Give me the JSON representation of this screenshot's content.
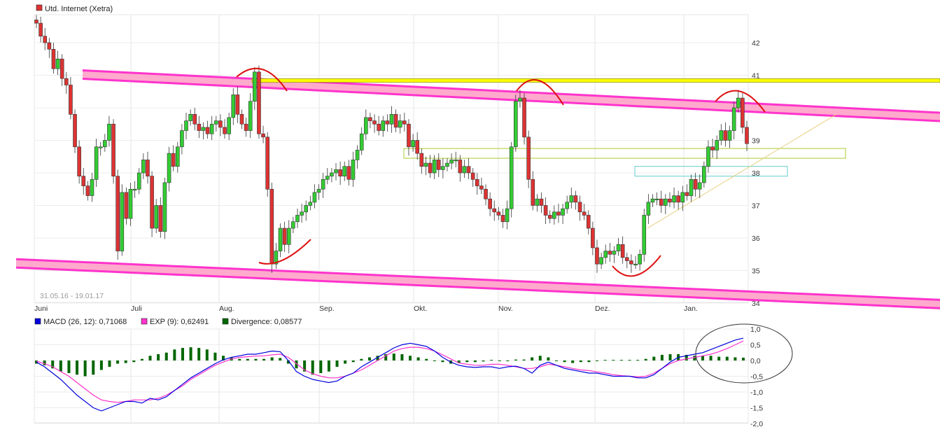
{
  "chart_data": [
    {
      "type": "candlestick",
      "title": "Utd. Internet (Xetra)",
      "date_range_label": "31.05.16 - 19.01.17",
      "x_ticks": [
        "Juni",
        "Juli",
        "Aug.",
        "Sep.",
        "Okt.",
        "Nov.",
        "Dez.",
        "Jan."
      ],
      "y_ticks": [
        "42",
        "41",
        "40",
        "39",
        "38",
        "37",
        "36",
        "35",
        "34"
      ],
      "ylim": [
        33.8,
        42.8
      ],
      "colors": {
        "up": "#33cc33",
        "down": "#dd3333",
        "channel": "#ff33cc",
        "channel_fill": "#ffaacc",
        "resistance": "#ffff00",
        "annotation": "#dd1111"
      },
      "closes": [
        42.6,
        42.2,
        42.0,
        41.8,
        41.2,
        41.5,
        40.9,
        40.7,
        39.8,
        38.8,
        37.9,
        37.6,
        37.3,
        37.8,
        38.8,
        38.8,
        39.0,
        39.5,
        37.9,
        35.6,
        37.4,
        36.6,
        37.5,
        37.5,
        38.0,
        38.4,
        37.9,
        36.3,
        37.0,
        36.2,
        37.7,
        38.6,
        38.2,
        38.8,
        39.3,
        39.6,
        39.8,
        39.5,
        39.3,
        39.4,
        39.2,
        39.5,
        39.6,
        39.4,
        39.2,
        39.7,
        40.4,
        39.8,
        39.5,
        39.3,
        40.2,
        41.1,
        39.2,
        39.1,
        37.5,
        35.2,
        35.6,
        36.3,
        35.8,
        36.3,
        36.5,
        36.7,
        36.8,
        37.0,
        37.1,
        37.4,
        37.5,
        37.8,
        37.9,
        38.0,
        38.1,
        37.9,
        38.2,
        37.8,
        38.4,
        38.7,
        39.2,
        39.7,
        39.6,
        39.5,
        39.3,
        39.6,
        39.5,
        39.8,
        39.4,
        39.6,
        39.5,
        38.8,
        39.0,
        38.6,
        38.2,
        38.3,
        38.0,
        38.4,
        38.1,
        38.2,
        38.3,
        38.4,
        38.4,
        38.0,
        38.2,
        38.0,
        37.8,
        37.6,
        37.5,
        37.2,
        36.9,
        36.8,
        36.7,
        36.5,
        36.9,
        38.8,
        40.2,
        40.3,
        39.1,
        37.8,
        37.0,
        37.2,
        37.0,
        36.7,
        36.6,
        36.8,
        36.7,
        36.9,
        37.1,
        37.3,
        37.1,
        36.8,
        36.7,
        36.3,
        35.7,
        35.2,
        35.4,
        35.6,
        35.5,
        35.6,
        35.8,
        35.4,
        35.3,
        35.2,
        35.2,
        35.5,
        36.7,
        37.1,
        37.2,
        37.2,
        37.0,
        37.2,
        37.1,
        37.3,
        37.1,
        37.4,
        37.3,
        37.8,
        37.5,
        37.7,
        38.2,
        38.8,
        38.7,
        39.0,
        39.3,
        39.0,
        39.3,
        40.0,
        40.3,
        39.4,
        38.9
      ],
      "overlays": {
        "channel_upper": [
          [
            2016.41,
            41.15
          ],
          [
            2017.13,
            39.85
          ]
        ],
        "channel_lower": [
          [
            2016.4,
            35.35
          ],
          [
            2017.13,
            34.1
          ]
        ],
        "resistance_level": 40.85,
        "box_yellow_green": [
          38.45,
          38.75
        ],
        "box_cyan": [
          37.9,
          38.2
        ]
      }
    },
    {
      "type": "line",
      "series": [
        {
          "name": "MACD (26, 12): 0,71068",
          "color": "#0000dd",
          "values": [
            -0.05,
            -0.2,
            -0.4,
            -0.6,
            -0.85,
            -1.1,
            -1.3,
            -1.5,
            -1.6,
            -1.5,
            -1.4,
            -1.3,
            -1.3,
            -1.35,
            -1.2,
            -1.25,
            -1.15,
            -0.95,
            -0.75,
            -0.55,
            -0.4,
            -0.25,
            -0.1,
            0.02,
            0.1,
            0.15,
            0.2,
            0.2,
            0.25,
            0.3,
            0.28,
            0.0,
            -0.35,
            -0.5,
            -0.6,
            -0.65,
            -0.7,
            -0.65,
            -0.5,
            -0.4,
            -0.2,
            -0.05,
            0.1,
            0.25,
            0.4,
            0.5,
            0.55,
            0.5,
            0.45,
            0.3,
            0.1,
            -0.05,
            -0.15,
            -0.2,
            -0.22,
            -0.2,
            -0.2,
            -0.25,
            -0.2,
            -0.18,
            -0.25,
            -0.4,
            -0.15,
            -0.05,
            -0.15,
            -0.25,
            -0.3,
            -0.35,
            -0.4,
            -0.4,
            -0.45,
            -0.5,
            -0.5,
            -0.5,
            -0.55,
            -0.55,
            -0.45,
            -0.25,
            -0.05,
            0.1,
            0.15,
            0.2,
            0.25,
            0.35,
            0.45,
            0.55,
            0.65,
            0.71
          ]
        },
        {
          "name": "EXP (9): 0,62491",
          "color": "#ff33cc",
          "values": [
            -0.02,
            -0.1,
            -0.2,
            -0.35,
            -0.5,
            -0.7,
            -0.9,
            -1.1,
            -1.25,
            -1.3,
            -1.33,
            -1.3,
            -1.25,
            -1.25,
            -1.25,
            -1.2,
            -1.1,
            -0.95,
            -0.8,
            -0.6,
            -0.45,
            -0.3,
            -0.15,
            -0.05,
            0.05,
            0.1,
            0.12,
            0.14,
            0.15,
            0.18,
            0.2,
            0.1,
            -0.1,
            -0.3,
            -0.42,
            -0.5,
            -0.55,
            -0.55,
            -0.5,
            -0.4,
            -0.3,
            -0.15,
            0.0,
            0.15,
            0.3,
            0.38,
            0.42,
            0.42,
            0.38,
            0.3,
            0.18,
            0.05,
            -0.08,
            -0.12,
            -0.15,
            -0.15,
            -0.12,
            -0.12,
            -0.15,
            -0.2,
            -0.25,
            -0.25,
            -0.2,
            -0.12,
            -0.15,
            -0.2,
            -0.25,
            -0.3,
            -0.32,
            -0.36,
            -0.4,
            -0.45,
            -0.48,
            -0.5,
            -0.52,
            -0.5,
            -0.4,
            -0.25,
            -0.1,
            0.0,
            0.05,
            0.1,
            0.15,
            0.2,
            0.28,
            0.38,
            0.5,
            0.62
          ]
        },
        {
          "name": "Divergence: 0,08577",
          "color": "#006600",
          "type": "bar",
          "values": [
            -0.1,
            -0.15,
            -0.25,
            -0.35,
            -0.4,
            -0.45,
            -0.5,
            -0.45,
            -0.3,
            -0.2,
            -0.1,
            -0.08,
            -0.05,
            0.05,
            0.15,
            0.2,
            0.25,
            0.35,
            0.4,
            0.42,
            0.4,
            0.35,
            0.25,
            0.15,
            0.1,
            0.05,
            0.05,
            0.05,
            0.05,
            0.1,
            0.08,
            -0.1,
            -0.25,
            -0.35,
            -0.45,
            -0.4,
            -0.35,
            -0.2,
            -0.1,
            -0.05,
            0.05,
            0.1,
            0.15,
            0.2,
            0.22,
            0.2,
            0.15,
            0.1,
            0.05,
            0.0,
            -0.05,
            -0.1,
            -0.08,
            -0.05,
            -0.05,
            -0.03,
            0.02,
            0.0,
            0.0,
            0.03,
            0.03,
            0.1,
            0.15,
            0.1,
            0.0,
            -0.05,
            -0.08,
            -0.05,
            -0.05,
            -0.02,
            0.02,
            0.02,
            0.02,
            0.02,
            0.02,
            0.05,
            0.12,
            0.18,
            0.2,
            0.2,
            0.18,
            0.15,
            0.15,
            0.15,
            0.12,
            0.12,
            0.1,
            0.09
          ]
        }
      ],
      "y_ticks": [
        "1,0",
        "0,5",
        "0,0",
        "-0,5",
        "-1,0",
        "-1,5",
        "-2,0"
      ],
      "ylim": [
        -2.0,
        1.0
      ]
    }
  ]
}
